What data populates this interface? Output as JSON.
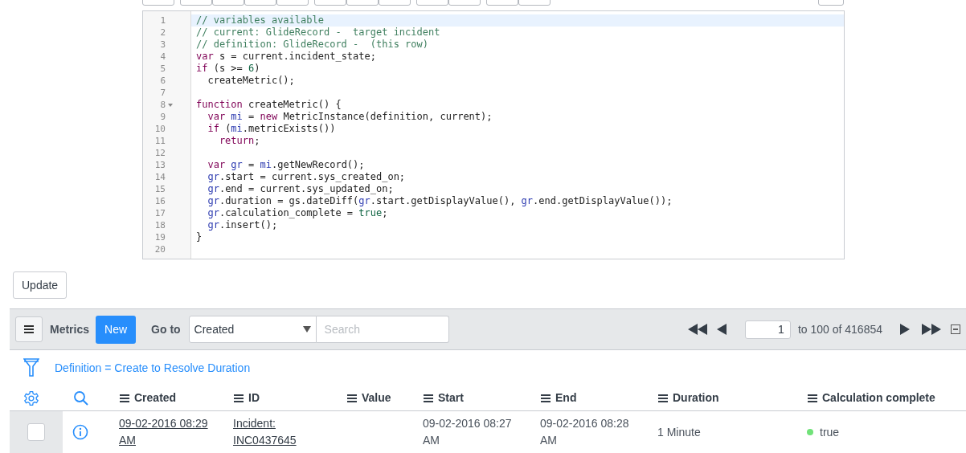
{
  "script_field": {
    "lines": [
      {
        "number": "1",
        "active": true,
        "foldable": false,
        "segments": [
          {
            "text": "// variables available",
            "kind": "comment"
          }
        ]
      },
      {
        "number": "2",
        "active": false,
        "foldable": false,
        "segments": [
          {
            "text": "// current: GlideRecord -  target incident",
            "kind": "comment"
          }
        ]
      },
      {
        "number": "3",
        "active": false,
        "foldable": false,
        "segments": [
          {
            "text": "// definition: GlideRecord -  (this row)",
            "kind": "comment"
          }
        ]
      },
      {
        "number": "4",
        "active": false,
        "foldable": false,
        "segments": [
          {
            "text": "var",
            "kind": "keyword"
          },
          {
            "text": " s = current.incident_state;",
            "kind": "plain"
          }
        ]
      },
      {
        "number": "5",
        "active": false,
        "foldable": false,
        "segments": [
          {
            "text": "if",
            "kind": "keyword"
          },
          {
            "text": " (s >= ",
            "kind": "plain"
          },
          {
            "text": "6",
            "kind": "literal"
          },
          {
            "text": ")",
            "kind": "plain"
          }
        ]
      },
      {
        "number": "6",
        "active": false,
        "foldable": false,
        "segments": [
          {
            "text": "  createMetric();",
            "kind": "plain"
          }
        ]
      },
      {
        "number": "7",
        "active": false,
        "foldable": false
      },
      {
        "number": "8",
        "active": false,
        "foldable": true,
        "segments": [
          {
            "text": "function",
            "kind": "keyword"
          },
          {
            "text": " createMetric() {",
            "kind": "plain"
          }
        ]
      },
      {
        "number": "9",
        "active": false,
        "foldable": false,
        "segments": [
          {
            "text": "  var ",
            "kind": "keyword"
          },
          {
            "text": "mi",
            "kind": "variable"
          },
          {
            "text": " = ",
            "kind": "plain"
          },
          {
            "text": "new",
            "kind": "keyword"
          },
          {
            "text": " MetricInstance(definition, current);",
            "kind": "plain"
          }
        ]
      },
      {
        "number": "10",
        "active": false,
        "foldable": false,
        "segments": [
          {
            "text": "  if",
            "kind": "keyword"
          },
          {
            "text": " (",
            "kind": "plain"
          },
          {
            "text": "mi",
            "kind": "variable"
          },
          {
            "text": ".metricExists())",
            "kind": "plain"
          }
        ]
      },
      {
        "number": "11",
        "active": false,
        "foldable": false,
        "segments": [
          {
            "text": "    return",
            "kind": "keyword"
          },
          {
            "text": ";",
            "kind": "plain"
          }
        ]
      },
      {
        "number": "12",
        "active": false,
        "foldable": false
      },
      {
        "number": "13",
        "active": false,
        "foldable": false,
        "segments": [
          {
            "text": "  var ",
            "kind": "keyword"
          },
          {
            "text": "gr",
            "kind": "variable"
          },
          {
            "text": " = ",
            "kind": "plain"
          },
          {
            "text": "mi",
            "kind": "variable"
          },
          {
            "text": ".getNewRecord();",
            "kind": "plain"
          }
        ]
      },
      {
        "number": "14",
        "active": false,
        "foldable": false,
        "segments": [
          {
            "text": "  gr",
            "kind": "variable"
          },
          {
            "text": ".start = current.sys_created_on;",
            "kind": "plain"
          }
        ]
      },
      {
        "number": "15",
        "active": false,
        "foldable": false,
        "segments": [
          {
            "text": "  gr",
            "kind": "variable"
          },
          {
            "text": ".end = current.sys_updated_on;",
            "kind": "plain"
          }
        ]
      },
      {
        "number": "16",
        "active": false,
        "foldable": false,
        "segments": [
          {
            "text": "  gr",
            "kind": "variable"
          },
          {
            "text": ".duration = gs.dateDiff(",
            "kind": "plain"
          },
          {
            "text": "gr",
            "kind": "variable"
          },
          {
            "text": ".start.getDisplayValue(), ",
            "kind": "plain"
          },
          {
            "text": "gr",
            "kind": "variable"
          },
          {
            "text": ".end.getDisplayValue());",
            "kind": "plain"
          }
        ]
      },
      {
        "number": "17",
        "active": false,
        "foldable": false,
        "segments": [
          {
            "text": "  gr",
            "kind": "variable"
          },
          {
            "text": ".calculation_complete = ",
            "kind": "plain"
          },
          {
            "text": "true",
            "kind": "literal"
          },
          {
            "text": ";",
            "kind": "plain"
          }
        ]
      },
      {
        "number": "18",
        "active": false,
        "foldable": false,
        "segments": [
          {
            "text": "  gr",
            "kind": "variable"
          },
          {
            "text": ".insert();",
            "kind": "plain"
          }
        ]
      },
      {
        "number": "19",
        "active": false,
        "foldable": false,
        "segments": [
          {
            "text": "}",
            "kind": "plain"
          }
        ]
      },
      {
        "number": "20",
        "active": false,
        "foldable": false
      }
    ]
  },
  "update_button": "Update",
  "list": {
    "title": "Metrics",
    "new_button": "New",
    "goto_label": "Go to",
    "goto_field": "Created",
    "search": {
      "placeholder": "Search"
    },
    "pager": {
      "page": "1",
      "range": "to 100 of 416854"
    },
    "filter": "Definition = Create to Resolve Duration",
    "columns": [
      "Created",
      "ID",
      "Value",
      "Start",
      "End",
      "Duration",
      "Calculation complete"
    ],
    "rows": [
      {
        "checked": false,
        "created": "09-02-2016 08:29 AM",
        "id": "Incident: INC0437645",
        "start": "09-02-2016 08:27 AM",
        "end": "09-02-2016 08:28 AM",
        "duration": "1 Minute",
        "calculation_complete": {
          "text": "true",
          "color": "#71e279"
        }
      }
    ]
  }
}
